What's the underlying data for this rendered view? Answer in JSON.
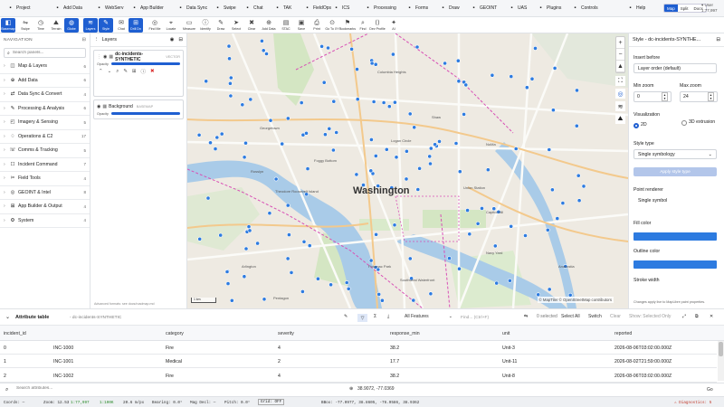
{
  "menubar": {
    "items": [
      {
        "label": "Project",
        "icon": "folder-icon"
      },
      {
        "label": "Add Data",
        "icon": "grid-icon"
      },
      {
        "label": "WebServ",
        "icon": "globe-icon"
      },
      {
        "label": "App Builder",
        "icon": "app-icon"
      },
      {
        "label": "Data Sync",
        "icon": "sync-icon"
      },
      {
        "label": "Swipe",
        "icon": "swipe-icon"
      },
      {
        "label": "Chat",
        "icon": "chat-icon"
      },
      {
        "label": "TAK",
        "icon": "tak-icon"
      },
      {
        "label": "FieldOps",
        "icon": "field-icon"
      },
      {
        "label": "ICS",
        "icon": "ics-icon"
      },
      {
        "label": "Processing",
        "icon": "cog-icon"
      },
      {
        "label": "Forms",
        "icon": "form-icon"
      },
      {
        "label": "Draw",
        "icon": "pencil-icon"
      },
      {
        "label": "GEOINT",
        "icon": "satellite-icon"
      },
      {
        "label": "UAS",
        "icon": "drone-icon"
      },
      {
        "label": "Plugins",
        "icon": "puzzle-icon"
      },
      {
        "label": "Controls",
        "icon": "sliders-icon"
      },
      {
        "label": "Help",
        "icon": "help-icon"
      }
    ],
    "view_modes": [
      "Map",
      "Split",
      "Docs"
    ],
    "extra_line1": "▾ User",
    "extra_line2": "1:77,997"
  },
  "toolbar": {
    "tools": [
      {
        "label": "Basemap",
        "icon": "map-icon",
        "active": true
      },
      {
        "label": "Swipe",
        "icon": "swipe-icon",
        "active": false
      },
      {
        "label": "Time",
        "icon": "clock-icon",
        "active": false
      },
      {
        "label": "Terrain",
        "icon": "mountain-icon",
        "active": false
      },
      {
        "label": "Globe",
        "icon": "globe-icon",
        "active": true
      },
      {
        "label": "Layers",
        "icon": "layers-icon",
        "active": true
      },
      {
        "label": "Style",
        "icon": "brush-icon",
        "active": true
      },
      {
        "label": "Chat",
        "icon": "chat-icon",
        "active": false
      },
      {
        "label": "Drill Dn",
        "icon": "drill-icon",
        "active": true
      },
      {
        "label": "Find Me",
        "icon": "locate-icon",
        "active": false
      },
      {
        "label": "Locate",
        "icon": "pin-icon",
        "active": false
      },
      {
        "label": "Measure",
        "icon": "ruler-icon",
        "active": false
      },
      {
        "label": "Identify",
        "icon": "info-icon",
        "active": false
      },
      {
        "label": "Draw",
        "icon": "pencil-icon",
        "active": false
      },
      {
        "label": "Select",
        "icon": "cursor-icon",
        "active": false
      },
      {
        "label": "Clear",
        "icon": "trash-icon",
        "active": false
      },
      {
        "label": "Add Data",
        "icon": "plus-icon",
        "active": false
      },
      {
        "label": "STAC",
        "icon": "stac-icon",
        "active": false
      },
      {
        "label": "Save",
        "icon": "save-icon",
        "active": false
      },
      {
        "label": "Print",
        "icon": "print-icon",
        "active": false
      },
      {
        "label": "Go To XY",
        "icon": "target-icon",
        "active": false
      },
      {
        "label": "Bookmarks",
        "icon": "bookmark-icon",
        "active": false
      },
      {
        "label": "Find",
        "icon": "search-icon",
        "active": false
      },
      {
        "label": "Dev Profile",
        "icon": "code-icon",
        "active": false
      },
      {
        "label": "AI",
        "icon": "sparkle-icon",
        "active": false
      }
    ]
  },
  "nav": {
    "title": "NAVIGATION",
    "search_placeholder": "Search panels...",
    "sections": [
      {
        "label": "Map & Layers",
        "count": "6"
      },
      {
        "label": "Add Data",
        "count": "6"
      },
      {
        "label": "Data Sync & Convert",
        "count": "4"
      },
      {
        "label": "Processing & Analysis",
        "count": "6"
      },
      {
        "label": "Imagery & Sensing",
        "count": "5"
      },
      {
        "label": "Operations & C2",
        "count": "17"
      },
      {
        "label": "Comms & Tracking",
        "count": "5"
      },
      {
        "label": "Incident Command",
        "count": "7"
      },
      {
        "label": "Field Tools",
        "count": "4"
      },
      {
        "label": "GEOINT & Intel",
        "count": "8"
      },
      {
        "label": "App Builder & Output",
        "count": "4"
      },
      {
        "label": "System",
        "count": "4"
      }
    ]
  },
  "layers": {
    "title": "Layers",
    "items": [
      {
        "name": "dc-incidents-SYNTHETIC",
        "sub": "VECTOR",
        "opacity_label": "Opacity",
        "opacity": 1.0
      },
      {
        "name": "Background",
        "sub": "BASEMAP",
        "opacity_label": "Opacity",
        "opacity": 1.0
      }
    ],
    "footer": "Advanced formats: see docs/roadmap.md"
  },
  "map": {
    "city": "Washington",
    "attribution": "© MapTiler © OpenStreetMap contributors",
    "scale": "1 km",
    "labels": [
      "Arlington",
      "Logan Circle",
      "Union Station",
      "Capitol Hill",
      "Theodore Roosevelt Island",
      "Navy Yard",
      "Pentagon",
      "Rosslyn",
      "Georgetown",
      "Foggy Bottom",
      "Potomac Park",
      "Anacostia",
      "Columbia Heights",
      "Shaw",
      "NoMa",
      "Southwest Waterfront"
    ],
    "accent_color": "#2d7be0"
  },
  "style_panel": {
    "title": "Style - dc-incidents-SYNTHE...",
    "insert_before_label": "Insert before",
    "insert_before_value": "Layer order (default)",
    "min_zoom_label": "Min zoom",
    "min_zoom": "0",
    "max_zoom_label": "Max zoom",
    "max_zoom": "24",
    "visualization_label": "Visualization",
    "viz_2d": "2D",
    "viz_3d": "3D extrusion",
    "style_type_label": "Style type",
    "style_type_value": "Single symbology",
    "apply_label": "Apply style type",
    "point_renderer_label": "Point renderer",
    "point_renderer_value": "Single symbol",
    "fill_color_label": "Fill color",
    "outline_color_label": "Outline color",
    "stroke_width_label": "Stroke width",
    "footer": "Changes apply live to MapLibre paint properties.",
    "fill_color": "#2d7be0",
    "outline_color": "#2d7be0"
  },
  "attr_table": {
    "title": "Attribute table",
    "subtitle": "- dc-incidents-SYNTHETIC",
    "filter_value": "All Features",
    "find_placeholder": "Find... (Ctrl+F)",
    "selected_count": "0 selected",
    "select_all": "Select All",
    "switch": "Switch",
    "clear": "Clear",
    "show_selected": "Show: Selected Only",
    "columns": [
      "incident_id",
      "category",
      "severity",
      "response_min",
      "unit",
      "reported"
    ],
    "rows": [
      {
        "idx": "0",
        "incident_id": "INC-1000",
        "category": "Fire",
        "severity": "4",
        "response_min": "38.2",
        "unit": "Unit-3",
        "reported": "2026-08-06T03:02:00.000Z"
      },
      {
        "idx": "1",
        "incident_id": "INC-1001",
        "category": "Medical",
        "severity": "2",
        "response_min": "17.7",
        "unit": "Unit-11",
        "reported": "2026-08-02T21:59:00.000Z"
      },
      {
        "idx": "2",
        "incident_id": "INC-1002",
        "category": "Fire",
        "severity": "4",
        "response_min": "38.2",
        "unit": "Unit-8",
        "reported": "2026-08-06T03:02:00.000Z"
      }
    ],
    "search_placeholder": "Search attributes...",
    "coords": "38.9072, -77.0369",
    "go": "Go"
  },
  "status": {
    "coords": "Coords: —",
    "zoom": "Zoom: 12.53",
    "scale": "1:77,997",
    "ratio": "1:100K",
    "res": "20.6 m/px",
    "bearing": "Bearing: 0.0°",
    "magdecl": "Mag Decl: —",
    "pitch": "Pitch: 0.0°",
    "grid": "Grid: OFF",
    "bbox": "BBox: -77.0977, 38.8605, -76.9586, 38.9362",
    "diagnostics": "Diagnostics: 5"
  }
}
